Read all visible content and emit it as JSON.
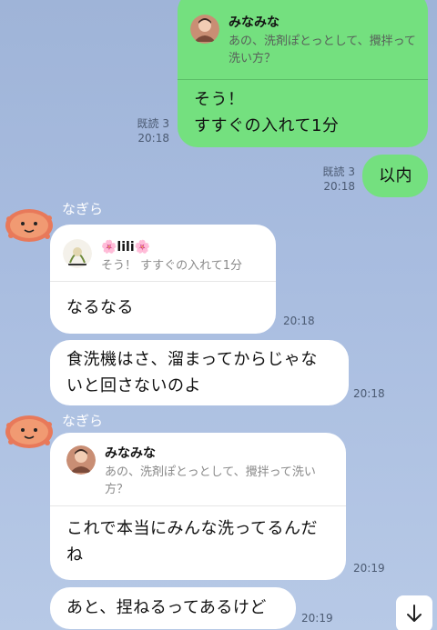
{
  "messages": [
    {
      "reply_name": "みなみな",
      "reply_quote": "あの、洗剤ぽとっとして、攪拌って洗い方？",
      "text_line1": "そう！",
      "text_line2": "すすぐの入れて1分",
      "read": "既読 3",
      "time": "20:18"
    },
    {
      "text": "以内",
      "read": "既読 3",
      "time": "20:18"
    },
    {
      "sender": "なぎら",
      "reply_name": "🌸lili🌸",
      "reply_quote": "そう！ すすぐの入れて1分",
      "text": "なるなる",
      "time": "20:18"
    },
    {
      "text_line1": "食洗機はさ、溜まってからじゃな",
      "text_line2": "いと回さないのよ",
      "time": "20:18"
    },
    {
      "sender": "なぎら",
      "reply_name": "みなみな",
      "reply_quote_line1": "あの、洗剤ぽとっとして、攪拌って洗い",
      "reply_quote_line2": "方？",
      "text_line1": "これで本当にみんな洗ってるんだ",
      "text_line2": "ね",
      "time": "20:19"
    },
    {
      "text": "あと、捏ねるってあるけど",
      "time": "20:19"
    }
  ],
  "colors": {
    "sent_bubble": "#74e07f",
    "received_bubble": "#ffffff",
    "background": "#a9bde0"
  },
  "icons": {
    "scroll_down": "arrow-down-icon"
  }
}
